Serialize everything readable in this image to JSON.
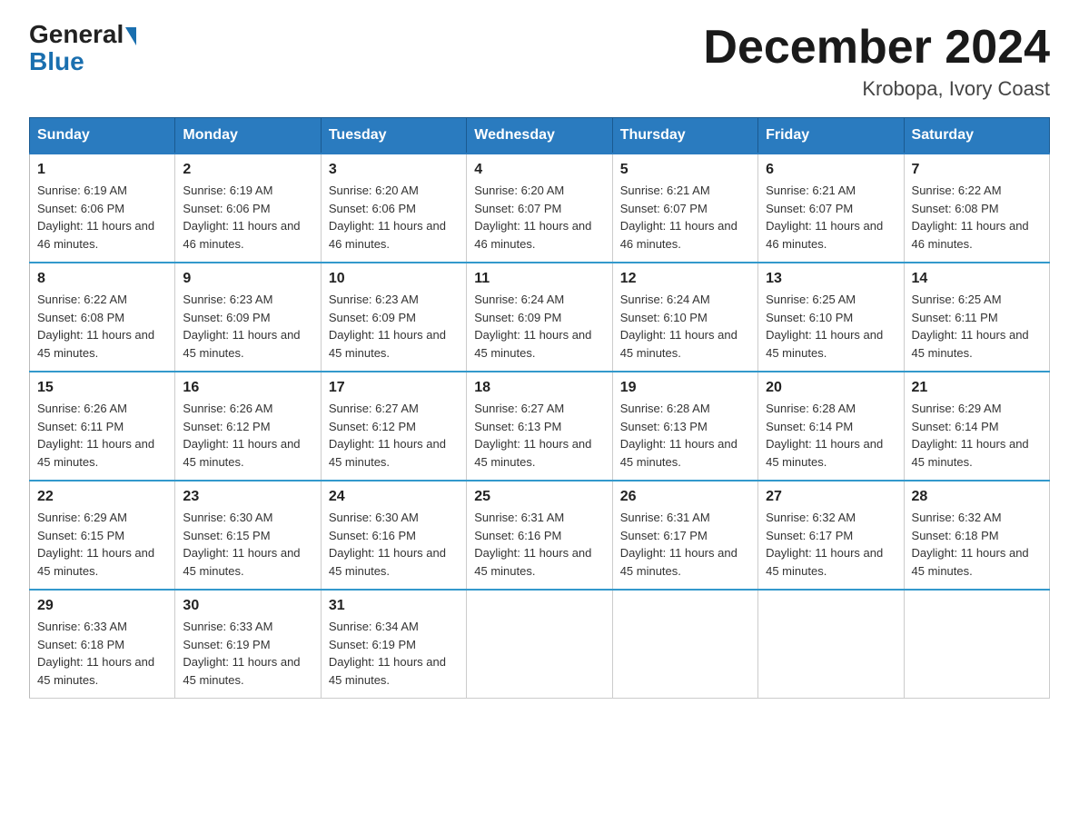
{
  "logo": {
    "general": "General",
    "blue": "Blue"
  },
  "title": "December 2024",
  "location": "Krobopa, Ivory Coast",
  "days_of_week": [
    "Sunday",
    "Monday",
    "Tuesday",
    "Wednesday",
    "Thursday",
    "Friday",
    "Saturday"
  ],
  "weeks": [
    [
      {
        "day": "1",
        "sunrise": "6:19 AM",
        "sunset": "6:06 PM",
        "daylight": "11 hours and 46 minutes."
      },
      {
        "day": "2",
        "sunrise": "6:19 AM",
        "sunset": "6:06 PM",
        "daylight": "11 hours and 46 minutes."
      },
      {
        "day": "3",
        "sunrise": "6:20 AM",
        "sunset": "6:06 PM",
        "daylight": "11 hours and 46 minutes."
      },
      {
        "day": "4",
        "sunrise": "6:20 AM",
        "sunset": "6:07 PM",
        "daylight": "11 hours and 46 minutes."
      },
      {
        "day": "5",
        "sunrise": "6:21 AM",
        "sunset": "6:07 PM",
        "daylight": "11 hours and 46 minutes."
      },
      {
        "day": "6",
        "sunrise": "6:21 AM",
        "sunset": "6:07 PM",
        "daylight": "11 hours and 46 minutes."
      },
      {
        "day": "7",
        "sunrise": "6:22 AM",
        "sunset": "6:08 PM",
        "daylight": "11 hours and 46 minutes."
      }
    ],
    [
      {
        "day": "8",
        "sunrise": "6:22 AM",
        "sunset": "6:08 PM",
        "daylight": "11 hours and 45 minutes."
      },
      {
        "day": "9",
        "sunrise": "6:23 AM",
        "sunset": "6:09 PM",
        "daylight": "11 hours and 45 minutes."
      },
      {
        "day": "10",
        "sunrise": "6:23 AM",
        "sunset": "6:09 PM",
        "daylight": "11 hours and 45 minutes."
      },
      {
        "day": "11",
        "sunrise": "6:24 AM",
        "sunset": "6:09 PM",
        "daylight": "11 hours and 45 minutes."
      },
      {
        "day": "12",
        "sunrise": "6:24 AM",
        "sunset": "6:10 PM",
        "daylight": "11 hours and 45 minutes."
      },
      {
        "day": "13",
        "sunrise": "6:25 AM",
        "sunset": "6:10 PM",
        "daylight": "11 hours and 45 minutes."
      },
      {
        "day": "14",
        "sunrise": "6:25 AM",
        "sunset": "6:11 PM",
        "daylight": "11 hours and 45 minutes."
      }
    ],
    [
      {
        "day": "15",
        "sunrise": "6:26 AM",
        "sunset": "6:11 PM",
        "daylight": "11 hours and 45 minutes."
      },
      {
        "day": "16",
        "sunrise": "6:26 AM",
        "sunset": "6:12 PM",
        "daylight": "11 hours and 45 minutes."
      },
      {
        "day": "17",
        "sunrise": "6:27 AM",
        "sunset": "6:12 PM",
        "daylight": "11 hours and 45 minutes."
      },
      {
        "day": "18",
        "sunrise": "6:27 AM",
        "sunset": "6:13 PM",
        "daylight": "11 hours and 45 minutes."
      },
      {
        "day": "19",
        "sunrise": "6:28 AM",
        "sunset": "6:13 PM",
        "daylight": "11 hours and 45 minutes."
      },
      {
        "day": "20",
        "sunrise": "6:28 AM",
        "sunset": "6:14 PM",
        "daylight": "11 hours and 45 minutes."
      },
      {
        "day": "21",
        "sunrise": "6:29 AM",
        "sunset": "6:14 PM",
        "daylight": "11 hours and 45 minutes."
      }
    ],
    [
      {
        "day": "22",
        "sunrise": "6:29 AM",
        "sunset": "6:15 PM",
        "daylight": "11 hours and 45 minutes."
      },
      {
        "day": "23",
        "sunrise": "6:30 AM",
        "sunset": "6:15 PM",
        "daylight": "11 hours and 45 minutes."
      },
      {
        "day": "24",
        "sunrise": "6:30 AM",
        "sunset": "6:16 PM",
        "daylight": "11 hours and 45 minutes."
      },
      {
        "day": "25",
        "sunrise": "6:31 AM",
        "sunset": "6:16 PM",
        "daylight": "11 hours and 45 minutes."
      },
      {
        "day": "26",
        "sunrise": "6:31 AM",
        "sunset": "6:17 PM",
        "daylight": "11 hours and 45 minutes."
      },
      {
        "day": "27",
        "sunrise": "6:32 AM",
        "sunset": "6:17 PM",
        "daylight": "11 hours and 45 minutes."
      },
      {
        "day": "28",
        "sunrise": "6:32 AM",
        "sunset": "6:18 PM",
        "daylight": "11 hours and 45 minutes."
      }
    ],
    [
      {
        "day": "29",
        "sunrise": "6:33 AM",
        "sunset": "6:18 PM",
        "daylight": "11 hours and 45 minutes."
      },
      {
        "day": "30",
        "sunrise": "6:33 AM",
        "sunset": "6:19 PM",
        "daylight": "11 hours and 45 minutes."
      },
      {
        "day": "31",
        "sunrise": "6:34 AM",
        "sunset": "6:19 PM",
        "daylight": "11 hours and 45 minutes."
      },
      null,
      null,
      null,
      null
    ]
  ],
  "labels": {
    "sunrise": "Sunrise:",
    "sunset": "Sunset:",
    "daylight": "Daylight:"
  }
}
